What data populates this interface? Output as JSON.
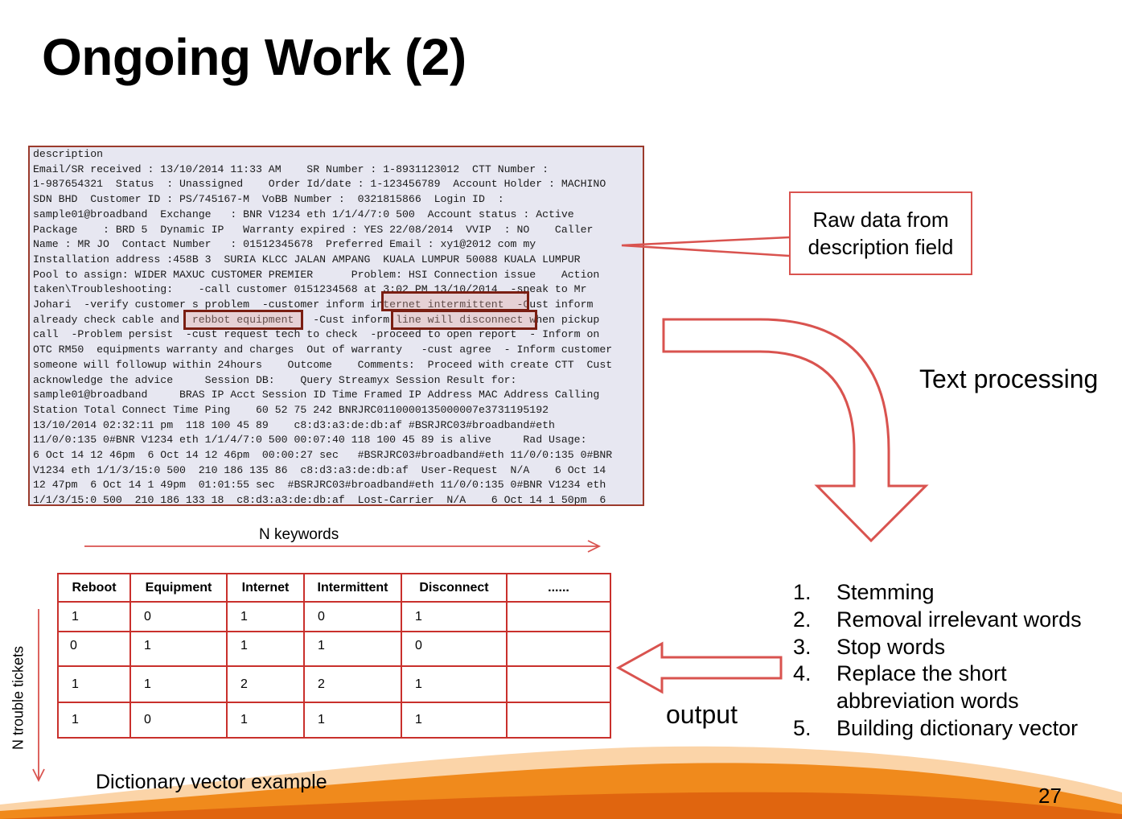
{
  "slide": {
    "title": "Ongoing Work (2)",
    "page_number": "27"
  },
  "raw_data": {
    "lines": [
      "description",
      "Email/SR received : 13/10/2014 11:33 AM    SR Number : 1-8931123012  CTT Number :",
      "1-987654321  Status  : Unassigned    Order Id/date : 1-123456789  Account Holder : MACHINO",
      "SDN BHD  Customer ID : PS/745167-M  VoBB Number :  0321815866  Login ID  :",
      "sample01@broadband  Exchange   : BNR V1234 eth 1/1/4/7:0 500  Account status : Active",
      "Package    : BRD 5  Dynamic IP   Warranty expired : YES 22/08/2014  VVIP  : NO    Caller",
      "Name : MR JO  Contact Number   : 01512345678  Preferred Email : xy1@2012 com my",
      "Installation address :458B 3  SURIA KLCC JALAN AMPANG  KUALA LUMPUR 50088 KUALA LUMPUR",
      "Pool to assign: WIDER MAXUC CUSTOMER PREMIER      Problem: HSI Connection issue    Action",
      "taken\\Troubleshooting:    -call customer 0151234568 at 3:02 PM 13/10/2014  -speak to Mr",
      "Johari  -verify customer s problem  -customer inform internet intermittent  -Cust inform",
      "already check cable and  rebbot equipment   -Cust inform line will disconnect when pickup",
      "call  -Problem persist  -cust request tech to check  -proceed to open report  - Inform on",
      "OTC RM50  equipments warranty and charges  Out of warranty   -cust agree  - Inform customer",
      "someone will followup within 24hours    Outcome    Comments:  Proceed with create CTT  Cust",
      "acknowledge the advice     Session DB:    Query Streamyx Session Result for:",
      "sample01@broadband     BRAS IP Acct Session ID Time Framed IP Address MAC Address Calling",
      "Station Total Connect Time Ping    60 52 75 242 BNRJRC0110000135000007e3731195192",
      "13/10/2014 02:32:11 pm  118 100 45 89    c8:d3:a3:de:db:af #BSRJRC03#broadband#eth",
      "11/0/0:135 0#BNR V1234 eth 1/1/4/7:0 500 00:07:40 118 100 45 89 is alive     Rad Usage:",
      "6 Oct 14 12 46pm  6 Oct 14 12 46pm  00:00:27 sec   #BSRJRC03#broadband#eth 11/0/0:135 0#BNR",
      "V1234 eth 1/1/3/15:0 500  210 186 135 86  c8:d3:a3:de:db:af  User-Request  N/A    6 Oct 14",
      "12 47pm  6 Oct 14 1 49pm  01:01:55 sec  #BSRJRC03#broadband#eth 11/0/0:135 0#BNR V1234 eth",
      "1/1/3/15:0 500  210 186 133 18  c8:d3:a3:de:db:af  Lost-Carrier  N/A    6 Oct 14 1 50pm  6"
    ]
  },
  "callout": {
    "line1": "Raw data from",
    "line2": "description field"
  },
  "labels": {
    "text_processing": "Text processing",
    "n_keywords": "N keywords",
    "n_trouble_tickets": "N trouble tickets",
    "output": "output",
    "dictionary_caption": "Dictionary vector example"
  },
  "dictionary": {
    "headers": [
      "Reboot",
      "Equipment",
      "Internet",
      "Intermittent",
      "Disconnect",
      "......"
    ],
    "rows": [
      [
        "1",
        "0",
        "1",
        "0",
        "1",
        ""
      ],
      [
        "0",
        "1",
        "1",
        "1",
        "0",
        ""
      ],
      [
        "1",
        "1",
        "2",
        "2",
        "1",
        ""
      ],
      [
        "1",
        "0",
        "1",
        "1",
        "1",
        ""
      ]
    ]
  },
  "steps": [
    {
      "num": "1.",
      "text": "Stemming"
    },
    {
      "num": "2.",
      "text": "Removal irrelevant words"
    },
    {
      "num": "3.",
      "text": "Stop words"
    },
    {
      "num": "4.",
      "text": "Replace the short"
    },
    {
      "num": "",
      "text": "abbreviation  words"
    },
    {
      "num": "5.",
      "text": "Building dictionary vector"
    }
  ],
  "colors": {
    "accent_red": "#d9534f",
    "highlight_border": "#7a1e12",
    "raw_bg": "#e7e7f1",
    "footer_orange": "#f08a1c"
  }
}
